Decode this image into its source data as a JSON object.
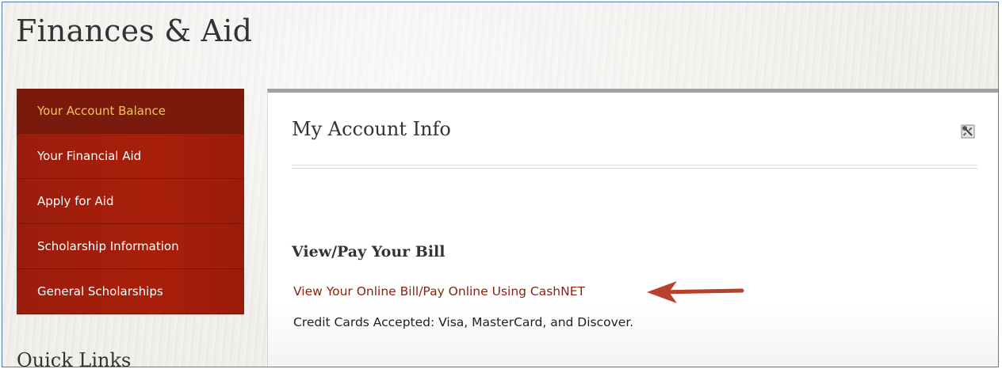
{
  "page": {
    "title": "Finances & Aid"
  },
  "sidebar": {
    "items": [
      {
        "label": "Your Account Balance",
        "active": true
      },
      {
        "label": "Your Financial Aid"
      },
      {
        "label": "Apply for Aid"
      },
      {
        "label": "Scholarship Information"
      },
      {
        "label": "General Scholarships"
      }
    ],
    "quick_links_heading": "Quick Links"
  },
  "panel": {
    "title": "My Account Info",
    "settings_icon": "settings-icon",
    "section_heading": "View/Pay Your Bill",
    "bill_link_label": "View Your Online Bill/Pay Online Using CashNET",
    "cards_note": "Credit Cards Accepted: Visa, MasterCard, and Discover."
  },
  "annotation": {
    "arrow_icon": "arrow-left-icon",
    "arrow_color": "#b8412b"
  },
  "colors": {
    "nav_background": "#a81f0a",
    "nav_active_background": "#7a1a0c",
    "nav_active_text": "#f2c35a",
    "link": "#8b2212",
    "frame_border": "#4e7cc0"
  }
}
